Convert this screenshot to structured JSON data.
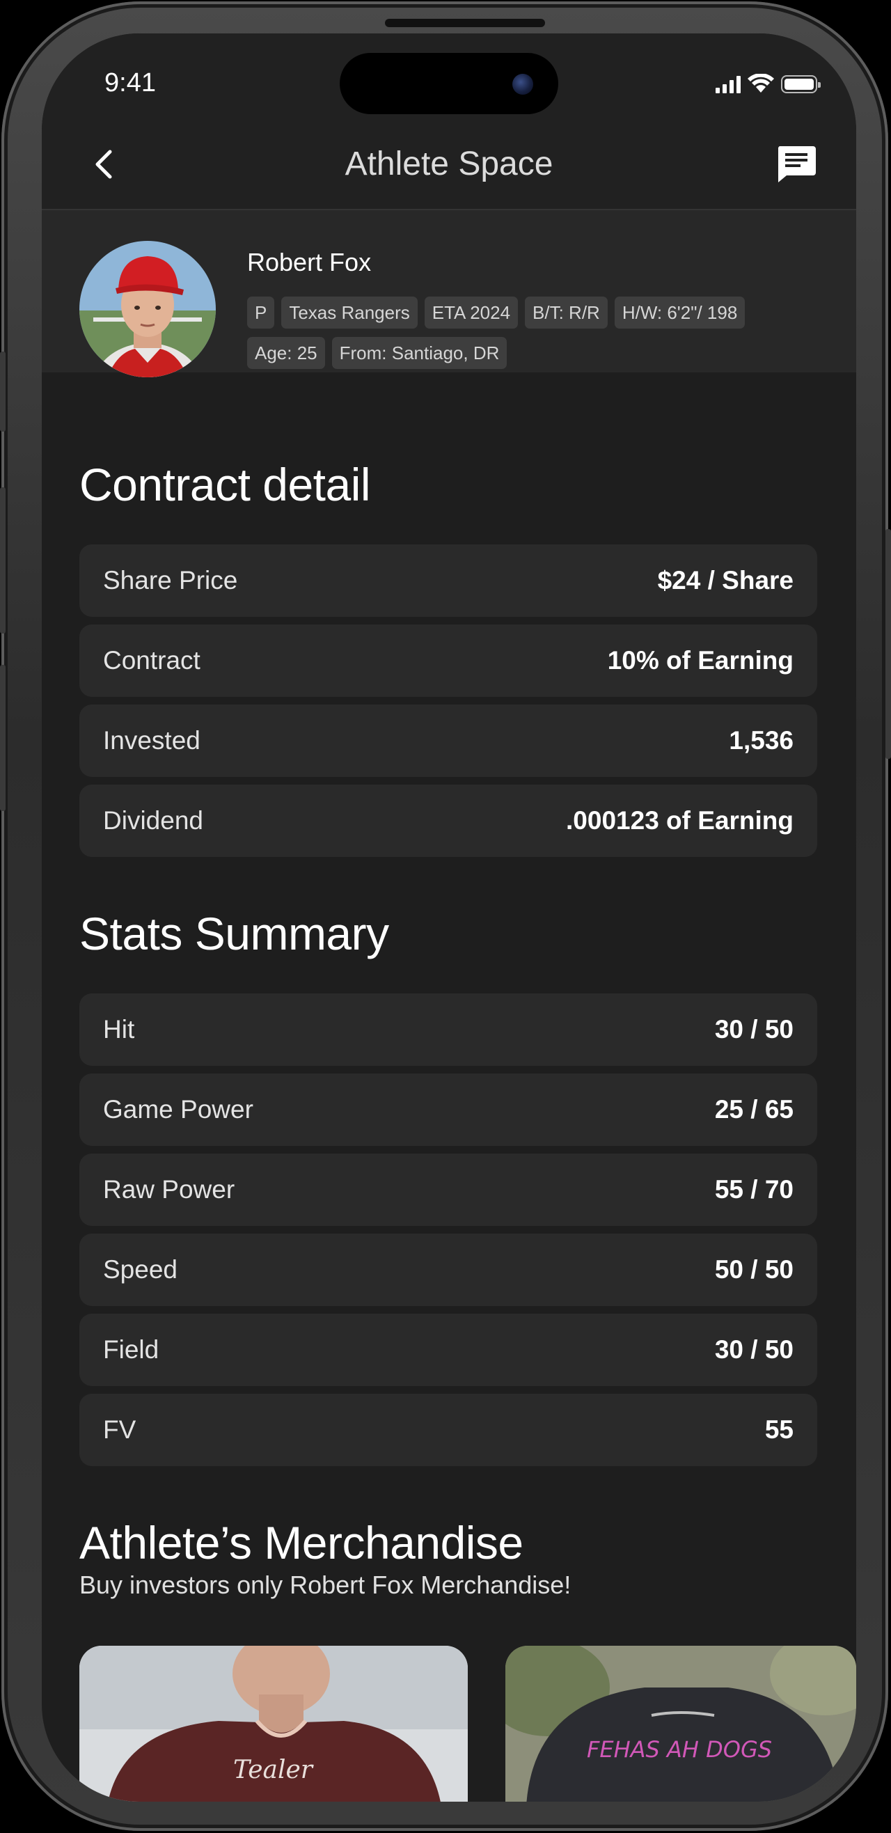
{
  "status_bar": {
    "time": "9:41"
  },
  "nav": {
    "title": "Athlete Space"
  },
  "profile": {
    "name": "Robert Fox",
    "tags": [
      "P",
      "Texas Rangers",
      "ETA 2024",
      "B/T: R/R",
      "H/W: 6'2\"/ 198",
      "Age: 25",
      "From: Santiago, DR"
    ]
  },
  "contract": {
    "title": "Contract detail",
    "rows": [
      {
        "label": "Share Price",
        "value": "$24 / Share"
      },
      {
        "label": "Contract",
        "value": "10% of Earning"
      },
      {
        "label": "Invested",
        "value": "1,536"
      },
      {
        "label": "Dividend",
        "value": ".000123 of Earning"
      }
    ]
  },
  "stats": {
    "title": "Stats Summary",
    "rows": [
      {
        "label": "Hit",
        "value": "30 / 50"
      },
      {
        "label": "Game Power",
        "value": "25 / 65"
      },
      {
        "label": "Raw Power",
        "value": "55 / 70"
      },
      {
        "label": "Speed",
        "value": "50 / 50"
      },
      {
        "label": "Field",
        "value": "30 / 50"
      },
      {
        "label": "FV",
        "value": "55"
      }
    ]
  },
  "merch": {
    "title": "Athlete’s Merchandise",
    "subtitle": "Buy investors only Robert Fox Merchandise!",
    "items": [
      {
        "print": "Tealer"
      },
      {
        "print": "FEHAS AH DOGS"
      }
    ]
  },
  "colors": {
    "background": "#1e1e1e",
    "card": "#2a2a2a",
    "tag": "#3e3e3e",
    "text": "#ffffff"
  }
}
